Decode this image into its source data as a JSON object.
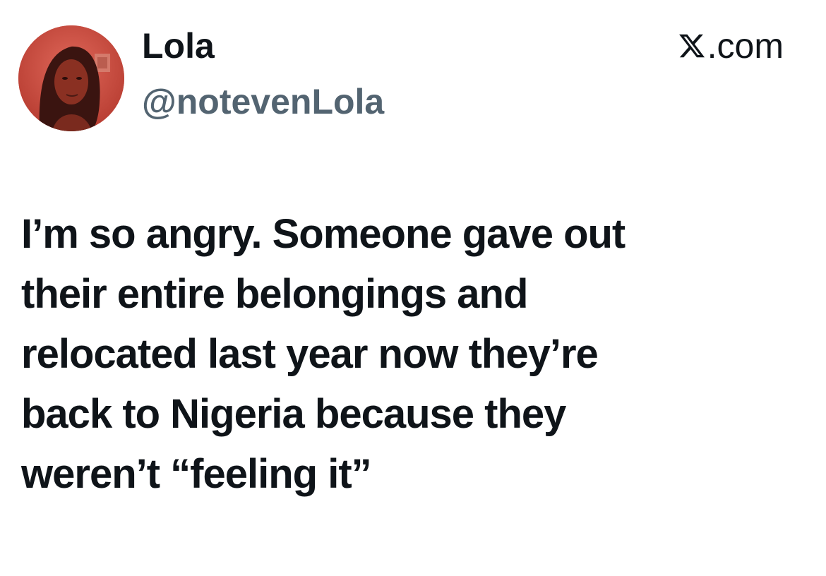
{
  "author": {
    "display_name": "Lola",
    "handle": "@notevenLola",
    "avatar_icon": "profile-photo"
  },
  "source": {
    "icon": "x-logo-icon",
    "suffix": ".com"
  },
  "tweet": {
    "lines": [
      "I’m so angry. Someone gave out",
      "their entire belongings and",
      "relocated last year now they’re",
      "back to Nigeria because they",
      "weren’t “feeling it”"
    ]
  },
  "colors": {
    "text_primary": "#0f1419",
    "text_secondary": "#536471",
    "background": "#ffffff",
    "avatar_tint": "#c8463a"
  }
}
